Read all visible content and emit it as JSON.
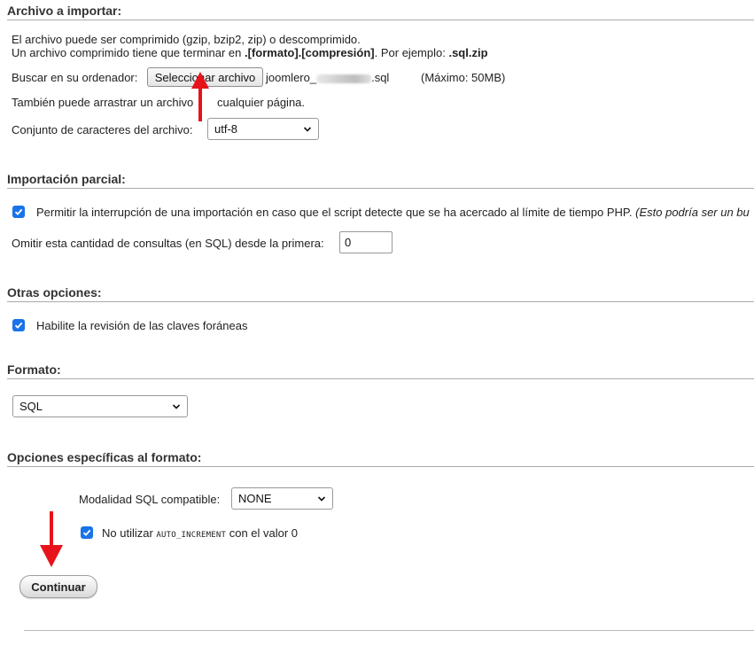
{
  "import_file": {
    "title": "Archivo a importar:",
    "compress_info_line1": "El archivo puede ser comprimido (gzip, bzip2, zip) o descomprimido.",
    "compress_info_line2_prefix": "Un archivo comprimido tiene que terminar en ",
    "compress_info_line2_bold": ".[formato].[compresión]",
    "compress_info_line2_mid": ". Por ejemplo: ",
    "compress_info_line2_example": ".sql.zip",
    "browse_label": "Buscar en su ordenador:",
    "select_file_button": "Seleccionar archivo",
    "file_name_prefix": "joomlero_",
    "file_name_suffix": ".sql",
    "max_size": "(Máximo: 50MB)",
    "drag_text_part1": "También puede arrastrar un archivo",
    "drag_text_part2": "cualquier página.",
    "charset_label": "Conjunto de caracteres del archivo:",
    "charset_value": "utf-8"
  },
  "partial_import": {
    "title": "Importación parcial:",
    "allow_interrupt_label": "Permitir la interrupción de una importación en caso que el script detecte que se ha acercado al límite de tiempo PHP.",
    "allow_interrupt_note": "(Esto podría ser un bu",
    "allow_interrupt_checked": true,
    "skip_queries_label": "Omitir esta cantidad de consultas (en SQL) desde la primera:",
    "skip_queries_value": "0"
  },
  "other_options": {
    "title": "Otras opciones:",
    "foreign_keys_label": "Habilite la revisión de las claves foráneas",
    "foreign_keys_checked": true
  },
  "format": {
    "title": "Formato:",
    "format_value": "SQL"
  },
  "format_specific": {
    "title": "Opciones específicas al formato:",
    "sql_compat_label": "Modalidad SQL compatible:",
    "sql_compat_value": "NONE",
    "no_auto_inc_prefix": "No utilizar",
    "no_auto_inc_code": "AUTO_INCREMENT",
    "no_auto_inc_suffix": "con el valor 0",
    "no_auto_inc_checked": true
  },
  "actions": {
    "continue_button": "Continuar"
  },
  "colors": {
    "checkbox_accent": "#1a73e8",
    "annotation_arrow": "#e8131a"
  },
  "icons": [
    "checkmark-icon",
    "chevron-down-icon",
    "annotation-arrow-icon"
  ]
}
